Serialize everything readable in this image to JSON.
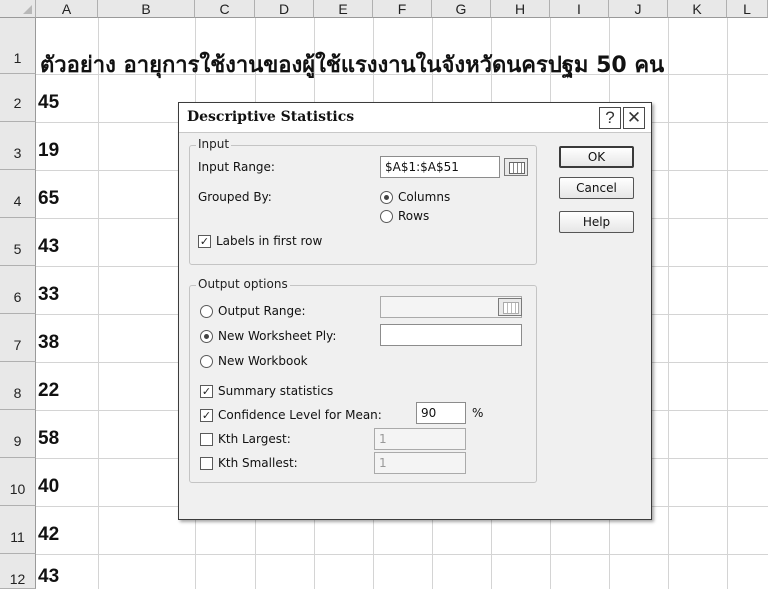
{
  "columns": [
    "A",
    "B",
    "C",
    "D",
    "E",
    "F",
    "G",
    "H",
    "I",
    "J",
    "K",
    "L"
  ],
  "rows": [
    "1",
    "2",
    "3",
    "4",
    "5",
    "6",
    "7",
    "8",
    "9",
    "10",
    "11",
    "12"
  ],
  "sheet": {
    "title": "ตัวอย่าง อายุการใช้งานของผู้ใช้แรงงานในจังหวัดนครปฐม 50 คน",
    "col_a_values": [
      "45",
      "19",
      "65",
      "43",
      "33",
      "38",
      "22",
      "58",
      "40",
      "42",
      "43"
    ]
  },
  "dialog": {
    "title": "Descriptive Statistics",
    "help_button": "?",
    "close_button": "✕",
    "input": {
      "legend": "Input",
      "input_range_label": "Input Range:",
      "input_range_value": "$A$1:$A$51",
      "grouped_by_label": "Grouped By:",
      "columns_label": "Columns",
      "rows_label": "Rows",
      "grouped_by_selected": "Columns",
      "labels_first_row_label": "Labels in first row",
      "labels_first_row_checked": true
    },
    "buttons": {
      "ok": "OK",
      "cancel": "Cancel",
      "help": "Help"
    },
    "output": {
      "legend": "Output options",
      "output_range_label": "Output Range:",
      "new_worksheet_label": "New Worksheet Ply:",
      "new_workbook_label": "New Workbook",
      "selected_option": "New Worksheet Ply",
      "summary_label": "Summary statistics",
      "summary_checked": true,
      "confidence_label": "Confidence Level for Mean:",
      "confidence_checked": true,
      "confidence_value": "90",
      "confidence_unit": "%",
      "kth_largest_label": "Kth Largest:",
      "kth_largest_checked": false,
      "kth_largest_value": "1",
      "kth_smallest_label": "Kth Smallest:",
      "kth_smallest_checked": false,
      "kth_smallest_value": "1"
    }
  }
}
